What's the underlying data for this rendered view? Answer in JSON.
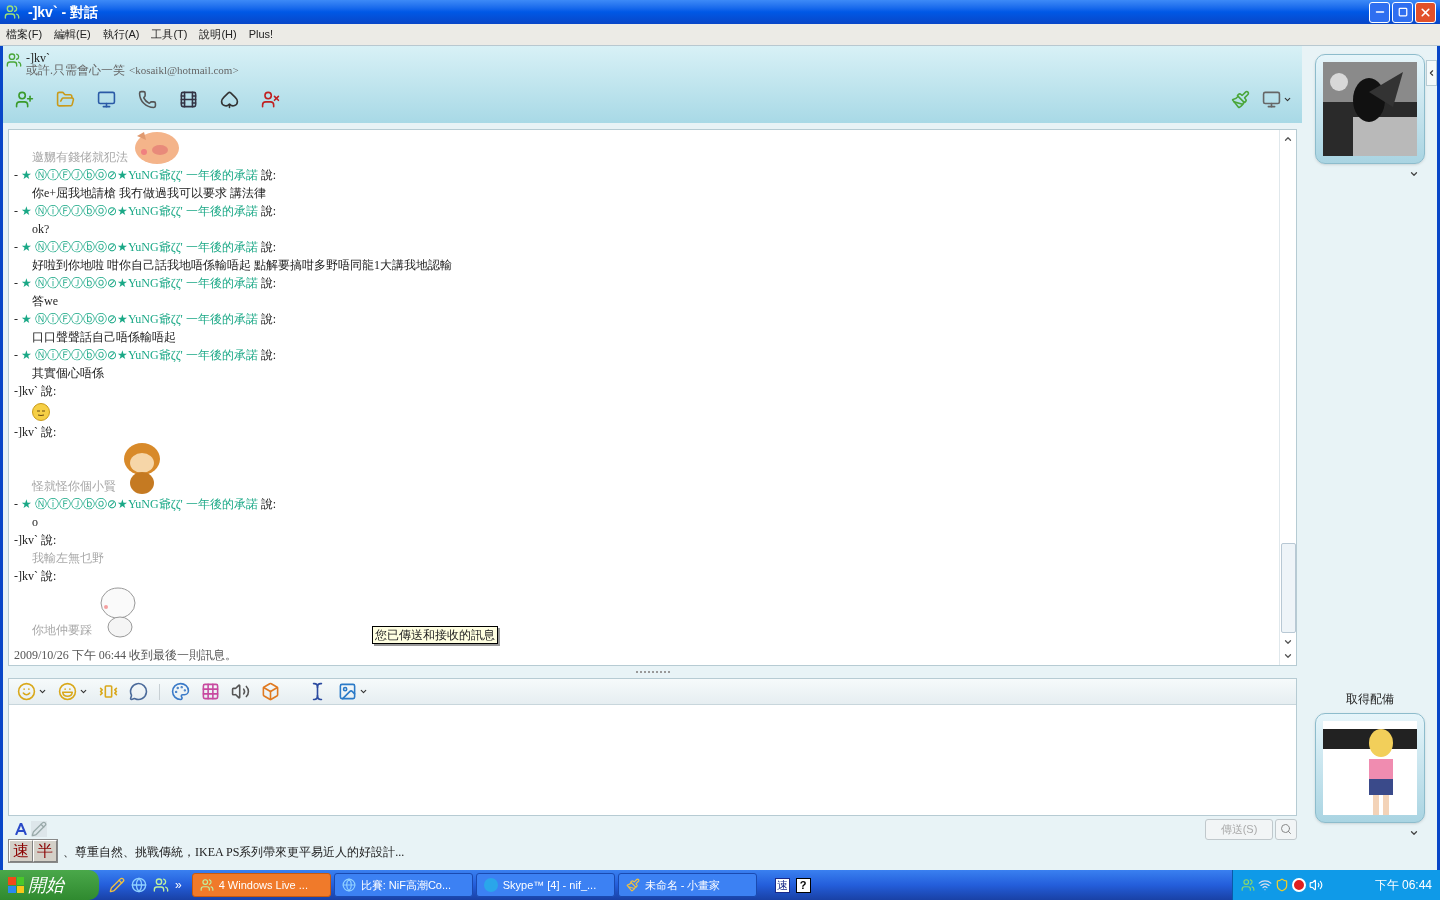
{
  "window": {
    "title": "-]kv` - 對話"
  },
  "menu": [
    "檔案(F)",
    "編輯(E)",
    "執行(A)",
    "工具(T)",
    "說明(H)",
    "Plus!"
  ],
  "contact": {
    "name": "-]kv`",
    "status_message": "或許.只需會心一笑",
    "email": "<kosaikl@hotmail.com>"
  },
  "history": [
    {
      "kind": "sticker",
      "text": "邀嬲有錢佬就犯法"
    },
    {
      "kind": "sender",
      "prefix": "- ",
      "name": "★ ⓃⓘⒻⒿⓑⓞ⊘★YuNG爺ζζ' 一年後的承諾",
      "color": "#1aa886",
      "says": "說:"
    },
    {
      "kind": "line",
      "text": "你e+屈我地請槍  我冇做過我可以要求 講法律"
    },
    {
      "kind": "sender",
      "prefix": "- ",
      "name": "★ ⓃⓘⒻⒿⓑⓞ⊘★YuNG爺ζζ' 一年後的承諾",
      "color": "#1aa886",
      "says": "說:"
    },
    {
      "kind": "line",
      "text": "ok?"
    },
    {
      "kind": "sender",
      "prefix": "- ",
      "name": "★ ⓃⓘⒻⒿⓑⓞ⊘★YuNG爺ζζ' 一年後的承諾",
      "color": "#1aa886",
      "says": "說:"
    },
    {
      "kind": "line",
      "text": "好啦到你地啦 咁你自己話我地唔係輸唔起 點解要搞咁多野唔同龍1大講我地認輸"
    },
    {
      "kind": "sender",
      "prefix": "- ",
      "name": "★ ⓃⓘⒻⒿⓑⓞ⊘★YuNG爺ζζ' 一年後的承諾",
      "color": "#1aa886",
      "says": "說:"
    },
    {
      "kind": "line",
      "text": "答we"
    },
    {
      "kind": "sender",
      "prefix": "- ",
      "name": "★ ⓃⓘⒻⒿⓑⓞ⊘★YuNG爺ζζ' 一年後的承諾",
      "color": "#1aa886",
      "says": "說:"
    },
    {
      "kind": "line",
      "text": "口口聲聲話自己唔係輸唔起"
    },
    {
      "kind": "sender",
      "prefix": "- ",
      "name": "★ ⓃⓘⒻⒿⓑⓞ⊘★YuNG爺ζζ' 一年後的承諾",
      "color": "#1aa886",
      "says": "說:"
    },
    {
      "kind": "line",
      "text": "其實個心唔係"
    },
    {
      "kind": "sender",
      "name": "-]kv`",
      "color": "#222222",
      "says": "說:"
    },
    {
      "kind": "emoticon"
    },
    {
      "kind": "sender",
      "name": "-]kv`",
      "color": "#222222",
      "says": "說:"
    },
    {
      "kind": "sticker",
      "text": "怪就怪你個小賢"
    },
    {
      "kind": "sender",
      "prefix": "- ",
      "name": "★ ⓃⓘⒻⒿⓑⓞ⊘★YuNG爺ζζ' 一年後的承諾",
      "color": "#1aa886",
      "says": "說:"
    },
    {
      "kind": "line",
      "text": "o"
    },
    {
      "kind": "sender",
      "name": "-]kv`",
      "color": "#222222",
      "says": "說:"
    },
    {
      "kind": "grey",
      "text": "我輸左無乜野"
    },
    {
      "kind": "sender",
      "name": "-]kv`",
      "color": "#222222",
      "says": "說:"
    },
    {
      "kind": "sticker",
      "text": "你地仲要踩"
    }
  ],
  "status": "2009/10/26 下午 06:44 收到最後一則訊息。",
  "tooltip": "您已傳送和接收的訊息",
  "send_button": {
    "label": "傳送(S)",
    "disabled": true
  },
  "accessories_link": "取得配備",
  "ad_text": "、尊重自然、挑戰傳統，IKEA PS系列帶來更平易近人的好設計...",
  "ime": [
    "速",
    "半"
  ],
  "taskbar": {
    "start": "開始",
    "more": "»",
    "tasks": [
      {
        "label": "4 Windows Live ...",
        "selected": true
      },
      {
        "label": "比賽: NiF高潮Co...",
        "selected": false
      },
      {
        "label": "Skype™ [4] - nif_...",
        "selected": false
      },
      {
        "label": "未命名 - 小畫家",
        "selected": false
      }
    ],
    "tray_ime": "速",
    "tray_help": "?",
    "clock": "下午 06:44"
  }
}
